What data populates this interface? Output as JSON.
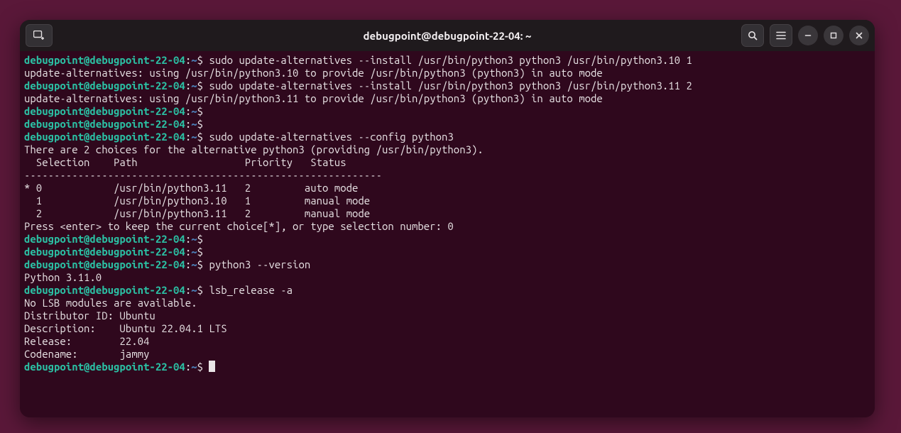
{
  "window": {
    "title": "debugpoint@debugpoint-22-04: ~"
  },
  "prompt": {
    "user": "debugpoint",
    "at": "@",
    "host": "debugpoint-22-04",
    "sep": ":",
    "path": "~",
    "sym": "$"
  },
  "lines": {
    "cmd1": "sudo update-alternatives --install /usr/bin/python3 python3 /usr/bin/python3.10 1",
    "out1": "update-alternatives: using /usr/bin/python3.10 to provide /usr/bin/python3 (python3) in auto mode",
    "cmd2": "sudo update-alternatives --install /usr/bin/python3 python3 /usr/bin/python3.11 2",
    "out2": "update-alternatives: using /usr/bin/python3.11 to provide /usr/bin/python3 (python3) in auto mode",
    "cmd3": "",
    "cmd4": "",
    "cmd5": "sudo update-alternatives --config python3",
    "out5a": "There are 2 choices for the alternative python3 (providing /usr/bin/python3).",
    "blank1": "",
    "header": "  Selection    Path                  Priority   Status",
    "divider": "------------------------------------------------------------",
    "row0": "* 0            /usr/bin/python3.11   2         auto mode",
    "row1": "  1            /usr/bin/python3.10   1         manual mode",
    "row2": "  2            /usr/bin/python3.11   2         manual mode",
    "blank2": "",
    "press": "Press <enter> to keep the current choice[*], or type selection number: 0",
    "cmd6": "",
    "cmd7": "",
    "cmd8": "python3 --version",
    "out8": "Python 3.11.0",
    "cmd9": "lsb_release -a",
    "out9a": "No LSB modules are available.",
    "out9b": "Distributor ID: Ubuntu",
    "out9c": "Description:    Ubuntu 22.04.1 LTS",
    "out9d": "Release:        22.04",
    "out9e": "Codename:       jammy",
    "cmd10": ""
  },
  "alternatives_table": {
    "columns": [
      "Selection",
      "Path",
      "Priority",
      "Status"
    ],
    "rows": [
      {
        "marker": "*",
        "selection": 0,
        "path": "/usr/bin/python3.11",
        "priority": 2,
        "status": "auto mode"
      },
      {
        "marker": " ",
        "selection": 1,
        "path": "/usr/bin/python3.10",
        "priority": 1,
        "status": "manual mode"
      },
      {
        "marker": " ",
        "selection": 2,
        "path": "/usr/bin/python3.11",
        "priority": 2,
        "status": "manual mode"
      }
    ]
  },
  "lsb_release": {
    "distributor_id": "Ubuntu",
    "description": "Ubuntu 22.04.1 LTS",
    "release": "22.04",
    "codename": "jammy"
  },
  "python_version": "Python 3.11.0"
}
